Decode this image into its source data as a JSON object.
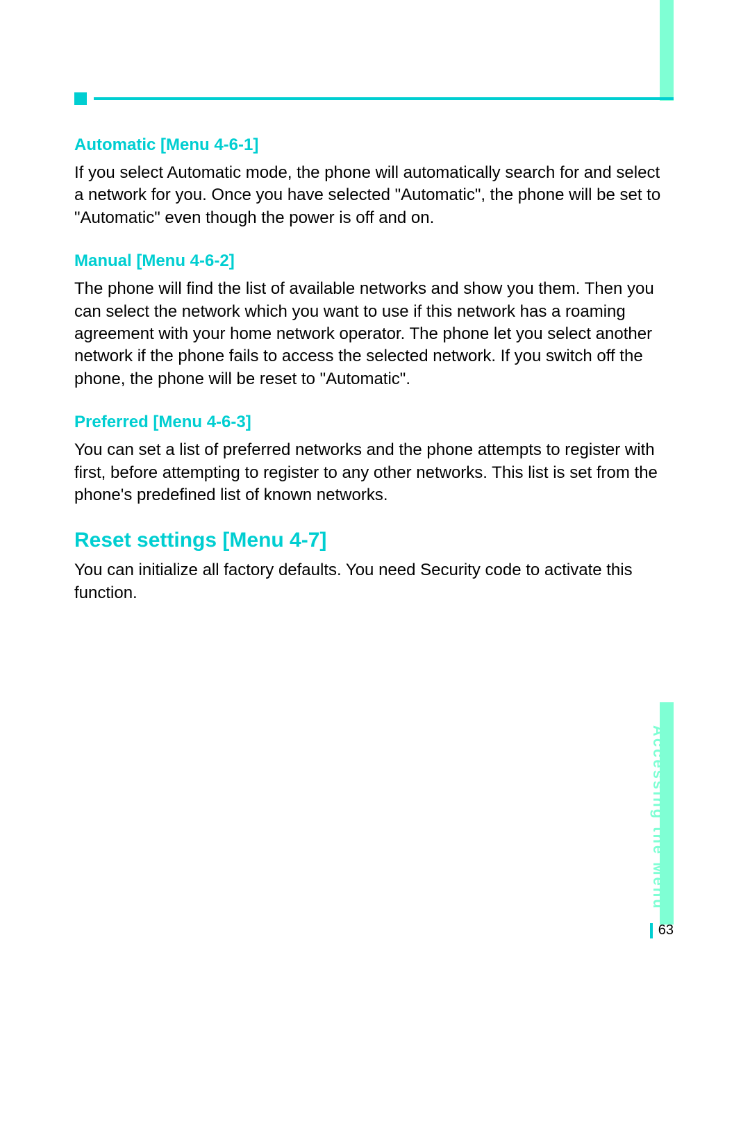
{
  "sections": {
    "automatic": {
      "heading": "Automatic [Menu 4-6-1]",
      "body": "If you select Automatic mode, the phone will automatically search for and select a network for you. Once you have selected \"Automatic\", the phone will be set to \"Automatic\" even though the power is off and on."
    },
    "manual": {
      "heading": "Manual [Menu 4-6-2]",
      "body": "The phone will find the list of available networks and show you them. Then you can select the network which you want to use if this network has a roaming agreement with your home network operator. The phone let you select another network if the phone fails to access the selected network. If you switch off the phone, the phone will be reset to \"Automatic\"."
    },
    "preferred": {
      "heading": "Preferred [Menu 4-6-3]",
      "body": "You can set a list of preferred networks and the phone attempts to register with first, before attempting to register to any other networks. This list is set from the phone's predefined list of known networks."
    },
    "reset": {
      "heading": "Reset settings [Menu 4-7]",
      "body": "You can initialize all factory defaults. You need Security code to activate this function."
    }
  },
  "sideTab": "Accessing the Menu",
  "pageNumber": "63"
}
